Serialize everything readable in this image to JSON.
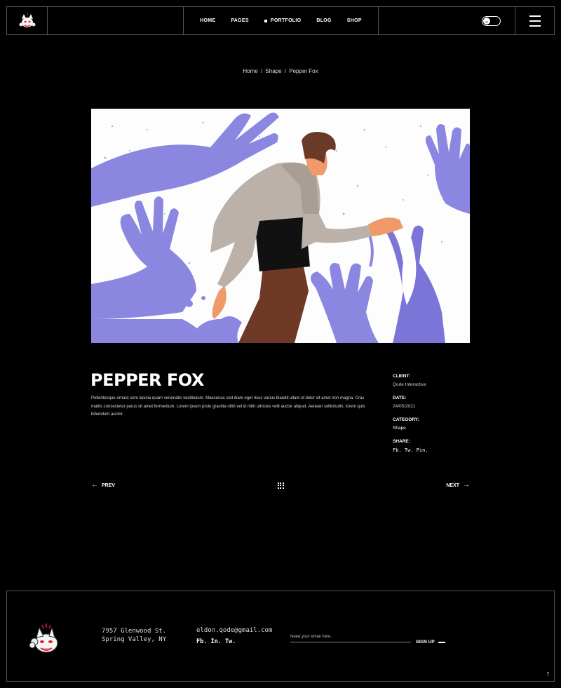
{
  "header": {
    "logo_alt": "fox logo",
    "nav": [
      {
        "label": "HOME",
        "active": false
      },
      {
        "label": "PAGES",
        "active": false
      },
      {
        "label": "PORTFOLIO",
        "active": true
      },
      {
        "label": "BLOG",
        "active": false
      },
      {
        "label": "SHOP",
        "active": false
      }
    ],
    "toggle_icon": "theme-toggle-icon",
    "menu_icon": "hamburger-icon"
  },
  "breadcrumb": {
    "home": "Home",
    "sep1": "/",
    "category": "Shape",
    "sep2": "/",
    "current": "Pepper Fox"
  },
  "project": {
    "title": "PEPPER FOX",
    "description": "Pellentesque ornare sem lacinia quam venenatis vestibulum. Maecenas sed diam eget risus varius blandit ullam id dolor sit amet non magna. Cras mattis consectetur purus sit amet fermentum. Lorem ipsum proin gravida nibh vel id nibh ultricies velit auctor aliquet. Aenean sollicitudin, lorem quis bibendum auctor.",
    "meta": {
      "client_label": "CLIENT:",
      "client": "Qode Interactive",
      "date_label": "DATE:",
      "date": "24/05/2021",
      "category_label": "CATEGORY:",
      "category": "Shape",
      "share_label": "SHARE:",
      "share": "Fb. Tw. Pin."
    }
  },
  "pager": {
    "prev": "PREV",
    "next": "NEXT"
  },
  "footer": {
    "address": "7957 Glenwood St. Spring Valley, NY",
    "email": "eldon.qode@gmail.com",
    "socials": "Fb. In. Tw.",
    "newsletter_placeholder": "Need your email here..",
    "signup": "SIGN UP"
  },
  "colors": {
    "background": "#000000",
    "border": "#555555",
    "accent_purple": "#8b87e0",
    "text": "#ffffff"
  }
}
